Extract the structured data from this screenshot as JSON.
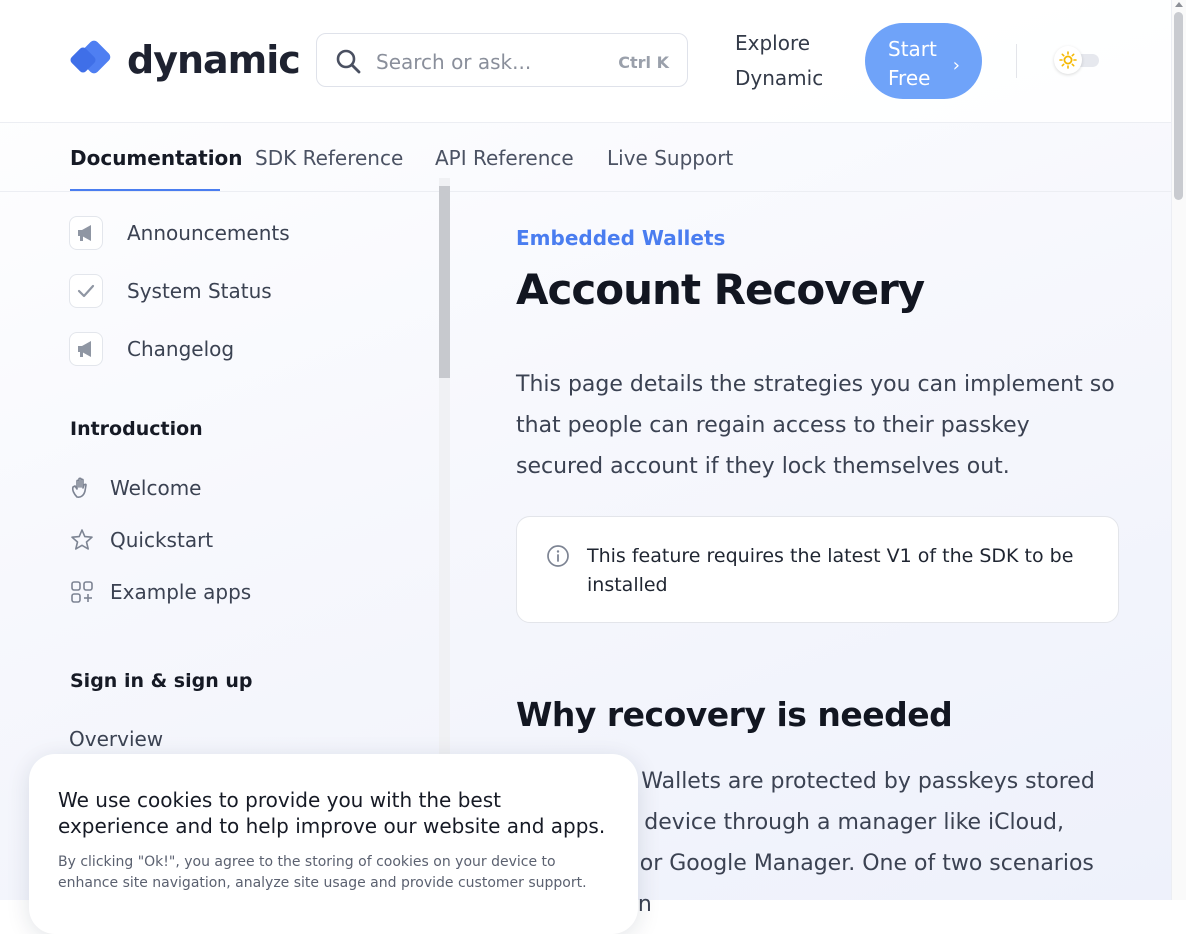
{
  "header": {
    "logo_text": "dynamic",
    "search_placeholder": "Search or ask...",
    "search_shortcut": "Ctrl K",
    "explore_label": "Explore Dynamic",
    "start_label": "Start Free",
    "theme_toggle_icon": "sun-icon"
  },
  "tabs": [
    {
      "label": "Documentation",
      "active": true
    },
    {
      "label": "SDK Reference",
      "active": false
    },
    {
      "label": "API Reference",
      "active": false
    },
    {
      "label": "Live Support",
      "active": false
    }
  ],
  "sidebar": {
    "top_items": [
      {
        "label": "Announcements",
        "icon": "megaphone-icon"
      },
      {
        "label": "System Status",
        "icon": "check-icon"
      },
      {
        "label": "Changelog",
        "icon": "megaphone-icon"
      }
    ],
    "sections": [
      {
        "title": "Introduction",
        "items": [
          {
            "label": "Welcome",
            "icon": "waving-hand-icon"
          },
          {
            "label": "Quickstart",
            "icon": "star-icon"
          },
          {
            "label": "Example apps",
            "icon": "apps-grid-icon"
          }
        ]
      },
      {
        "title": "Sign in & sign up",
        "items": [
          {
            "label": "Overview"
          }
        ]
      }
    ]
  },
  "content": {
    "eyebrow": "Embedded Wallets",
    "title": "Account Recovery",
    "intro": "This page details the strategies you can implement so that people can regain access to their passkey secured account if they lock themselves out.",
    "callout_icon": "info-icon",
    "callout_text": "This feature requires the latest V1 of the SDK to be installed",
    "section_title": "Why recovery is needed",
    "section_body": "Embedded Wallets are protected by passkeys stored on a user’s device through a manager like iCloud, 1Password or Google Manager. One of two scenarios can result in"
  },
  "cookie": {
    "headline": "We use cookies to provide you with the best experience and to help improve our website and apps.",
    "detail": "By clicking \"Ok!\", you agree to the storing of cookies on your device to enhance site navigation, analyze site usage and provide customer support."
  },
  "colors": {
    "accent": "#4a7df0",
    "cta": "#6fa3f9",
    "sun": "#f5b800"
  }
}
